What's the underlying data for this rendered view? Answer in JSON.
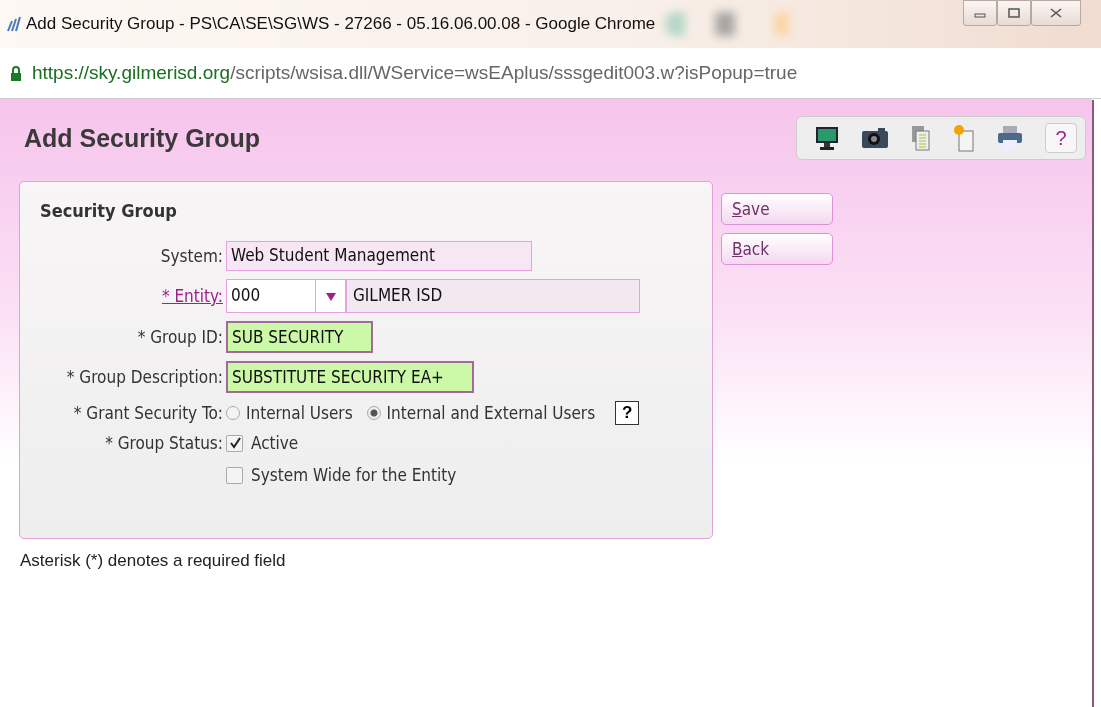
{
  "window": {
    "title": "Add Security Group - PS\\CA\\SE\\SG\\WS - 27266 - 05.16.06.00.08 - Google Chrome"
  },
  "address_bar": {
    "host": "https://sky.gilmerisd.org",
    "path": "/scripts/wsisa.dll/WService=wsEAplus/sssgedit003.w?isPopup=true"
  },
  "page": {
    "title": "Add Security Group",
    "toolbar": [
      {
        "kind": "monitor"
      },
      {
        "kind": "camera"
      },
      {
        "kind": "copy"
      },
      {
        "kind": "new"
      },
      {
        "kind": "print"
      },
      {
        "kind": "help",
        "label": "?"
      }
    ]
  },
  "panel": {
    "title": "Security Group",
    "fields": [
      {
        "kind": "readonly",
        "label": "System:",
        "value": "Web Student Management"
      },
      {
        "kind": "entity",
        "label": "* Entity:",
        "code": "000",
        "name": "GILMER ISD"
      },
      {
        "kind": "text",
        "label": "* Group ID:",
        "value": "SUB SECURITY"
      },
      {
        "kind": "text",
        "label": "* Group Description:",
        "value": "SUBSTITUTE SECURITY EA+"
      },
      {
        "kind": "radio",
        "label": "* Grant Security To:",
        "options": [
          {
            "label": "Internal Users",
            "selected": false
          },
          {
            "label": "Internal and External Users",
            "selected": true
          }
        ],
        "help": "?"
      },
      {
        "kind": "checkbox",
        "label": "* Group Status:",
        "options": [
          {
            "label": "Active",
            "checked": true
          },
          {
            "label": "System Wide for the Entity",
            "checked": false
          }
        ]
      }
    ]
  },
  "buttons": [
    {
      "label": "Save"
    },
    {
      "label": "Back"
    }
  ],
  "footnote": "Asterisk (*) denotes a required field"
}
